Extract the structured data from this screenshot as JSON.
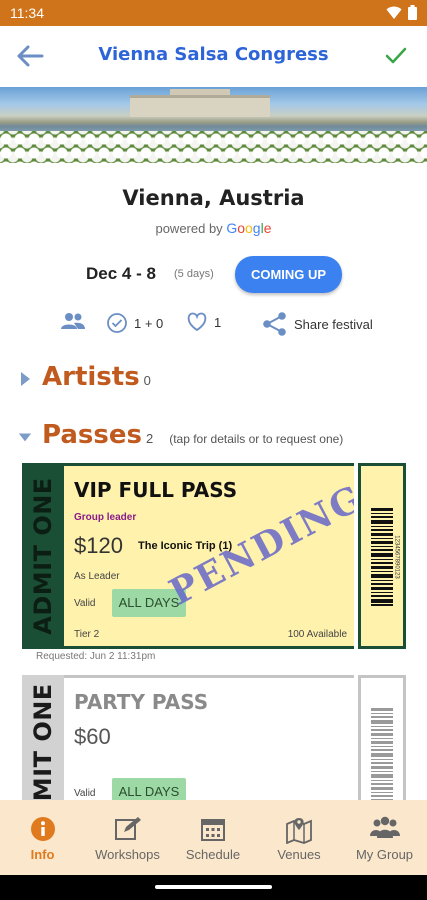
{
  "status_bar": {
    "time": "11:34"
  },
  "app_bar": {
    "title": "Vienna Salsa Congress"
  },
  "event": {
    "location": "Vienna, Austria",
    "powered_by": "powered by",
    "google": [
      "G",
      "o",
      "o",
      "g",
      "l",
      "e"
    ],
    "google_colors": [
      "#4285F4",
      "#EA4335",
      "#FBBC05",
      "#4285F4",
      "#34A853",
      "#EA4335"
    ],
    "dates": "Dec 4 - 8",
    "duration": "(5 days)",
    "status_button": "COMING UP"
  },
  "stats": {
    "checked": "1 + 0",
    "likes": "1",
    "share": "Share festival"
  },
  "sections": {
    "artists": {
      "name": "Artists",
      "count": "0"
    },
    "passes": {
      "name": "Passes",
      "count": "2",
      "hint": "(tap for details or to request one)"
    }
  },
  "passes": [
    {
      "stub": "ADMIT ONE",
      "name": "VIP FULL PASS",
      "role": "Group leader",
      "price": "$120",
      "group": "The Iconic Trip (1)",
      "as_role": "As Leader",
      "valid_label": "Valid",
      "valid_value": "ALL DAYS",
      "tier": "Tier 2",
      "available": "100 Available",
      "stamp": "PENDING",
      "requested": "Requested: Jun 2 11:31pm",
      "barcode_number": "1234567890123"
    },
    {
      "stub": "ADMIT ONE",
      "name": "PARTY PASS",
      "price": "$60",
      "valid_label": "Valid",
      "valid_value": "ALL DAYS"
    }
  ],
  "bottom_nav": [
    {
      "label": "Info",
      "icon": "info-icon",
      "active": true
    },
    {
      "label": "Workshops",
      "icon": "edit-icon",
      "active": false
    },
    {
      "label": "Schedule",
      "icon": "calendar-icon",
      "active": false
    },
    {
      "label": "Venues",
      "icon": "map-icon",
      "active": false
    },
    {
      "label": "My Group",
      "icon": "group-icon",
      "active": false
    }
  ],
  "colors": {
    "status_bar": "#d0741c",
    "accent_blue": "#3b82f0",
    "section_heading": "#c05a1e",
    "ticket_green": "#1b4f35",
    "ticket_yellow": "#fef2ad",
    "nav_bg": "#fbe7cb",
    "nav_active": "#e07a1f"
  }
}
